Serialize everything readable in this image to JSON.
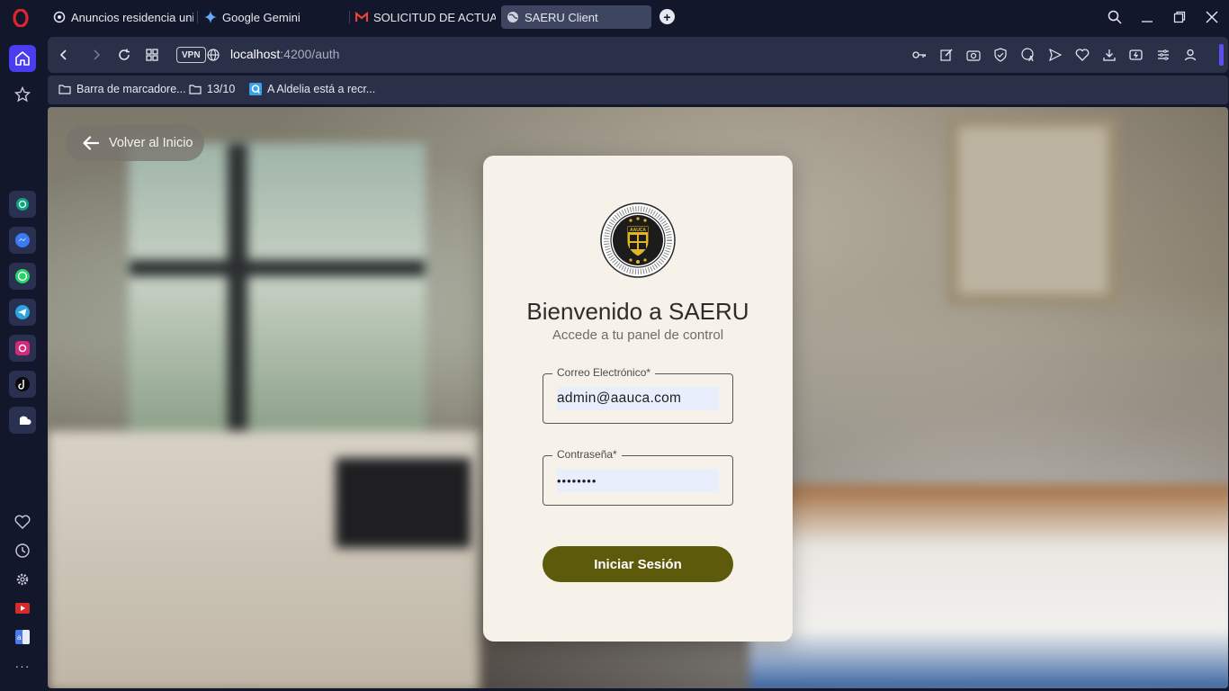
{
  "browser": {
    "tabs": [
      {
        "title": "Anuncios residencia unive",
        "active": false
      },
      {
        "title": "Google Gemini",
        "active": false
      },
      {
        "title": "SOLICITUD DE ACTUALIZA",
        "active": false
      },
      {
        "title": "SAERU Client",
        "active": true
      }
    ],
    "url_host": "localhost",
    "url_path": ":4200/auth",
    "vpn_label": "VPN",
    "bookmarks": [
      {
        "label": "Barra de marcadore...",
        "icon": "folder-icon"
      },
      {
        "label": "13/10",
        "icon": "folder-icon"
      },
      {
        "label": "A Aldelia está a recr...",
        "icon": "site-icon"
      }
    ],
    "accent_color": "#4a3cf0"
  },
  "sidebar": {
    "apps": [
      "chatgpt-icon",
      "messenger-icon",
      "whatsapp-icon",
      "telegram-icon",
      "instagram-icon",
      "tiktok-icon",
      "soundcloud-icon"
    ],
    "more_label": "···"
  },
  "page": {
    "back_label": "Volver al Inicio",
    "title": "Bienvenido a SAERU",
    "subtitle": "Accede a tu panel de control",
    "email_label": "Correo Electrónico*",
    "email_value": "admin@aauca.com",
    "password_label": "Contraseña*",
    "password_value": "••••••••",
    "submit_label": "Iniciar Sesión",
    "seal_ring_text": "ASIA-AMERICAN UNIVERSITY OF CENTRAL AMERICA",
    "seal_shield_text": "AAUCA",
    "brand_color": "#5e5a0b",
    "card_color": "#f6f2ea"
  }
}
